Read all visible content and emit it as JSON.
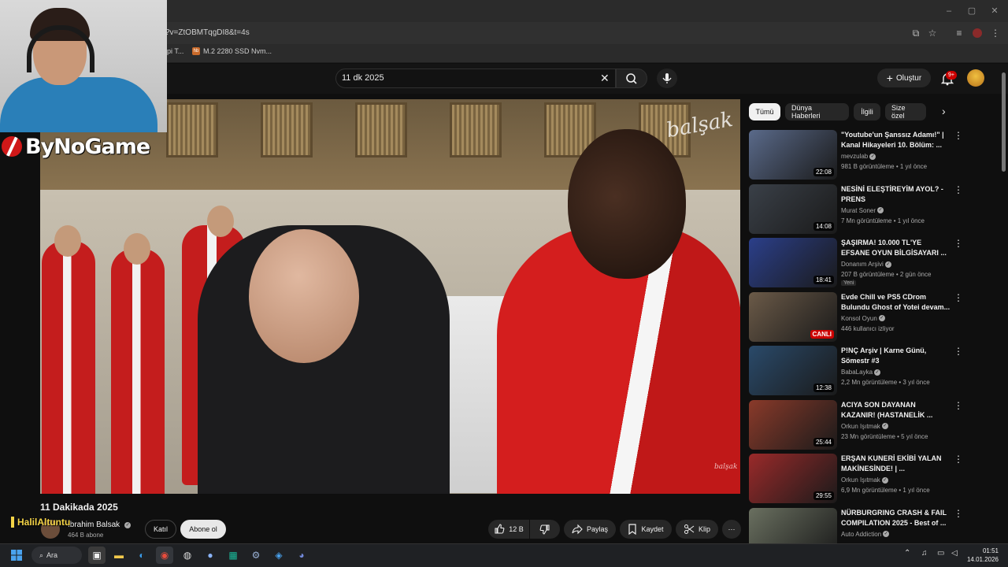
{
  "browser": {
    "url_fragment": "?v=ZtOBMTqgDI8&t=4s",
    "bookmarks": [
      {
        "label": "pi T...",
        "icon": "bookmark-icon"
      },
      {
        "label": "M.2 2280 SSD Nvm...",
        "icon": "hb-icon",
        "fav": "hb"
      }
    ],
    "window_controls": [
      "–",
      "▢",
      "✕"
    ]
  },
  "youtube": {
    "search_value": "11 dk 2025",
    "create_label": "Oluştur",
    "notifications_badge": "9+",
    "chips": [
      "Tümü",
      "Dünya Haberleri",
      "İlgili",
      "Size özel"
    ]
  },
  "video": {
    "title": "11 Dakikada 2025",
    "watermark": "balşak",
    "watermark_small": "balşak",
    "channel_name": "Ibrahim Balsak",
    "subscribers": "464 B abone",
    "join_label": "Katıl",
    "subscribe_label": "Abone ol",
    "likes": "12 B",
    "share_label": "Paylaş",
    "save_label": "Kaydet",
    "clip_label": "Klip"
  },
  "stream_overlay": {
    "brand": "ByNoGame",
    "streamer_name": "HalilAltuntu"
  },
  "recommended": [
    {
      "title": "\"Youtube'un Şanssız Adamı!\" | Kanal Hikayeleri 10. Bölüm: ...",
      "channel": "mevzulab",
      "meta": "981 B görüntüleme • 1 yıl önce",
      "duration": "22:08",
      "thumb_color": "#5a6a8a",
      "verified": true
    },
    {
      "title": "NESİNİ ELEŞTİREYİM AYOL? - PRENS",
      "channel": "Murat Soner",
      "meta": "7 Mn görüntüleme • 1 yıl önce",
      "duration": "14:08",
      "thumb_color": "#3a4048",
      "verified": true
    },
    {
      "title": "ŞAŞIRMA! 10.000 TL'YE EFSANE OYUN BİLGİSAYARI ...",
      "channel": "Donanım Arşivi",
      "meta": "207 B görüntüleme • 2 gün önce",
      "duration": "18:41",
      "badge": "Yeni",
      "thumb_color": "#2b3f8a",
      "verified": true
    },
    {
      "title": "Evde Chill ve PS5 CDrom Bulundu Ghost of Yotei devam...",
      "channel": "Konsol Oyun",
      "meta": "446 kullanıcı izliyor",
      "live": "CANLI",
      "thumb_color": "#6b5a48",
      "verified": true
    },
    {
      "title": "P!NÇ Arşiv | Karne Günü, Sömestr #3",
      "channel": "BabaLayka",
      "meta": "2,2 Mn görüntüleme • 3 yıl önce",
      "duration": "12:38",
      "thumb_color": "#2a4a6a",
      "verified": true
    },
    {
      "title": "ACIYA SON DAYANAN KAZANIR! (HASTANELİK ...",
      "channel": "Orkun Işıtmak",
      "meta": "23 Mn görüntüleme • 5 yıl önce",
      "duration": "25:44",
      "thumb_color": "#8a3a2a",
      "verified": true
    },
    {
      "title": "ERŞAN KUNERİ EKİBİ YALAN MAKİNESİNDE! | ...",
      "channel": "Orkun Işıtmak",
      "meta": "6,9 Mn görüntüleme • 1 yıl önce",
      "duration": "29:55",
      "thumb_color": "#9a2a2a",
      "verified": true
    },
    {
      "title": "NÜRBURGRING CRASH & FAIL COMPILATION 2025 - Best of ...",
      "channel": "Auto Addiction",
      "meta": "",
      "thumb_color": "#6a7060",
      "verified": true
    }
  ],
  "taskbar": {
    "search_label": "Ara",
    "time": "01:51",
    "date": "14.01.2026"
  },
  "colors": {
    "accent_red": "#cc0000",
    "overlay_yellow": "#f5d447"
  }
}
